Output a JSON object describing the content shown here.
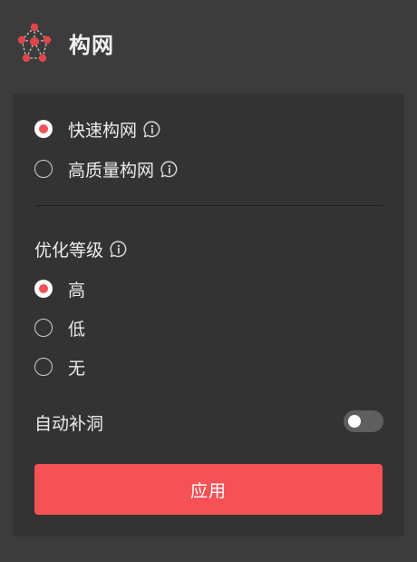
{
  "header": {
    "title": "构网",
    "logo_icon": "mesh-network-icon",
    "accent_color": "#e0454b"
  },
  "mode": {
    "options": [
      {
        "label": "快速构网",
        "selected": true,
        "info_icon": "info-icon"
      },
      {
        "label": "高质量构网",
        "selected": false,
        "info_icon": "info-icon"
      }
    ]
  },
  "optimization": {
    "title": "优化等级",
    "info_icon": "info-icon",
    "options": [
      {
        "label": "高",
        "selected": true
      },
      {
        "label": "低",
        "selected": false
      },
      {
        "label": "无",
        "selected": false
      }
    ]
  },
  "fill_holes": {
    "label": "自动补洞",
    "enabled": false
  },
  "apply_button": {
    "label": "应用",
    "color": "#f65155"
  }
}
